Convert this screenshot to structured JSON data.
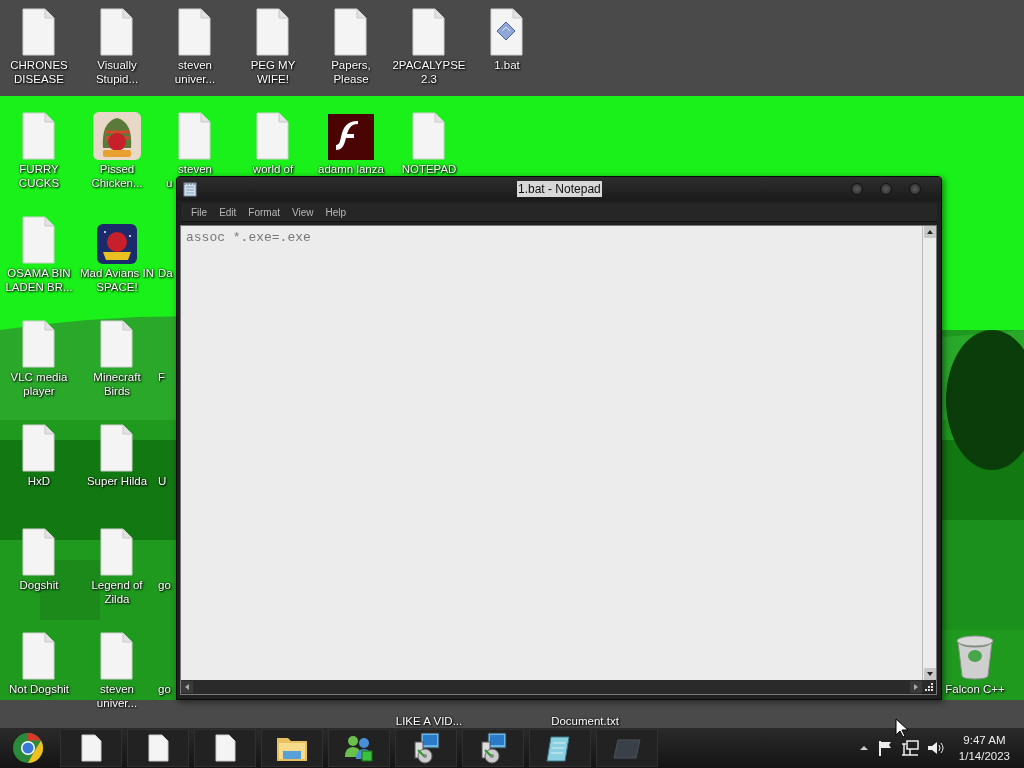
{
  "desktop": {
    "rows": [
      {
        "icons": [
          {
            "kind": "file",
            "label": "CHRONES DISEASE"
          },
          {
            "kind": "file",
            "label": "Visually Stupid..."
          },
          {
            "kind": "file",
            "label": "steven univer..."
          },
          {
            "kind": "file",
            "label": "PEG MY WIFE!"
          },
          {
            "kind": "file",
            "label": "Papers, Please"
          },
          {
            "kind": "file",
            "label": "2PACALYPSE 2.3"
          },
          {
            "kind": "bat",
            "label": "1.bat"
          }
        ]
      },
      {
        "icons": [
          {
            "kind": "file",
            "label": "FURRY CUCKS"
          },
          {
            "kind": "seasons-game",
            "label": "Pissed Chicken..."
          },
          {
            "kind": "file-cut",
            "label": "steven",
            "cut_line": "u"
          },
          {
            "kind": "file",
            "label": "world of"
          },
          {
            "kind": "flash",
            "label": "adamn lanza"
          },
          {
            "kind": "file",
            "label": "NOTEPAD"
          }
        ]
      },
      {
        "icons": [
          {
            "kind": "file",
            "label": "OSAMA BIN LADEN BR..."
          },
          {
            "kind": "space-game",
            "label": "Mad Avians IN SPACE!"
          },
          {
            "kind": "cut",
            "label": "Da"
          }
        ]
      },
      {
        "icons": [
          {
            "kind": "file",
            "label": "VLC media player"
          },
          {
            "kind": "file",
            "label": "Minecraft Birds"
          },
          {
            "kind": "cut",
            "label": "F"
          }
        ]
      },
      {
        "icons": [
          {
            "kind": "file",
            "label": "HxD"
          },
          {
            "kind": "file",
            "label": "Super Hilda"
          },
          {
            "kind": "cut",
            "label": "U"
          }
        ]
      },
      {
        "icons": [
          {
            "kind": "file",
            "label": "Dogshit"
          },
          {
            "kind": "file",
            "label": "Legend of Zilda"
          },
          {
            "kind": "cut",
            "label": "go"
          }
        ]
      },
      {
        "icons": [
          {
            "kind": "file",
            "label": "Not Dogshit"
          },
          {
            "kind": "file",
            "label": "steven univer..."
          },
          {
            "kind": "cut",
            "label": "go"
          },
          {
            "kind": "hidden"
          },
          {
            "kind": "hidden"
          },
          {
            "kind": "under",
            "label": "LIKE A VID..."
          },
          {
            "kind": "hidden"
          },
          {
            "kind": "under",
            "label": "Document.txt"
          },
          {
            "kind": "hidden"
          },
          {
            "kind": "hidden"
          },
          {
            "kind": "hidden"
          },
          {
            "kind": "hidden"
          },
          {
            "kind": "recycle",
            "label": "Falcon C++"
          }
        ]
      }
    ]
  },
  "notepad": {
    "title": "1.bat - Notepad",
    "menu": [
      "File",
      "Edit",
      "Format",
      "View",
      "Help"
    ],
    "content": "assoc *.exe=.exe"
  },
  "taskbar": {
    "buttons": [
      {
        "kind": "file"
      },
      {
        "kind": "file"
      },
      {
        "kind": "file"
      },
      {
        "kind": "folder"
      },
      {
        "kind": "messenger"
      },
      {
        "kind": "installer"
      },
      {
        "kind": "installer"
      },
      {
        "kind": "notepad"
      },
      {
        "kind": "blank"
      }
    ],
    "tray": [
      {
        "kind": "arrow"
      },
      {
        "kind": "flag"
      },
      {
        "kind": "network"
      },
      {
        "kind": "volume"
      }
    ],
    "time": "9:47 AM",
    "date": "1/14/2023"
  }
}
